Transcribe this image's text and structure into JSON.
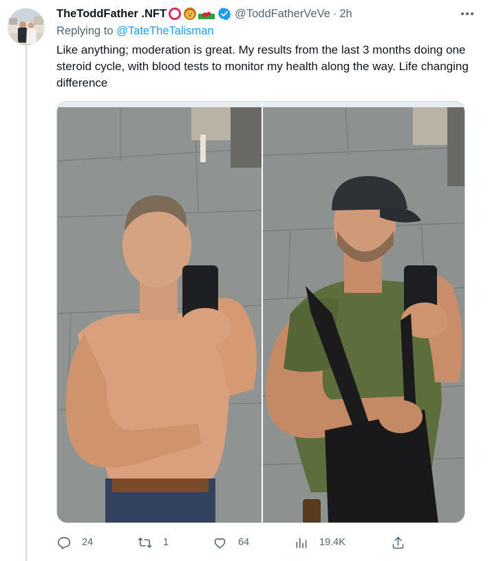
{
  "tweet": {
    "display_name": "TheToddFather .NFT",
    "name_emojis": [
      "red-circle-icon",
      "lion-icon",
      "wales-flag-icon"
    ],
    "verified_icon": "verified-badge-icon",
    "handle": "@ToddFatherVeVe",
    "separator": "·",
    "time": "2h",
    "replying_prefix": "Replying to",
    "replying_to": "@TateTheTalisman",
    "text": "Like anything; moderation is great. My results from the last 3 months doing one steroid cycle, with blood tests to monitor my health along the way. Life changing difference"
  },
  "media": {
    "images": [
      "before-photo",
      "after-photo"
    ]
  },
  "actions": {
    "reply": {
      "icon": "reply-icon",
      "count": "24"
    },
    "retweet": {
      "icon": "retweet-icon",
      "count": "1"
    },
    "like": {
      "icon": "heart-icon",
      "count": "64"
    },
    "views": {
      "icon": "views-icon",
      "count": "19.4K"
    },
    "share": {
      "icon": "share-icon"
    }
  },
  "colors": {
    "link": "#1d9bf0",
    "muted": "#536471",
    "text": "#0f1419",
    "border": "#cfd9de"
  }
}
